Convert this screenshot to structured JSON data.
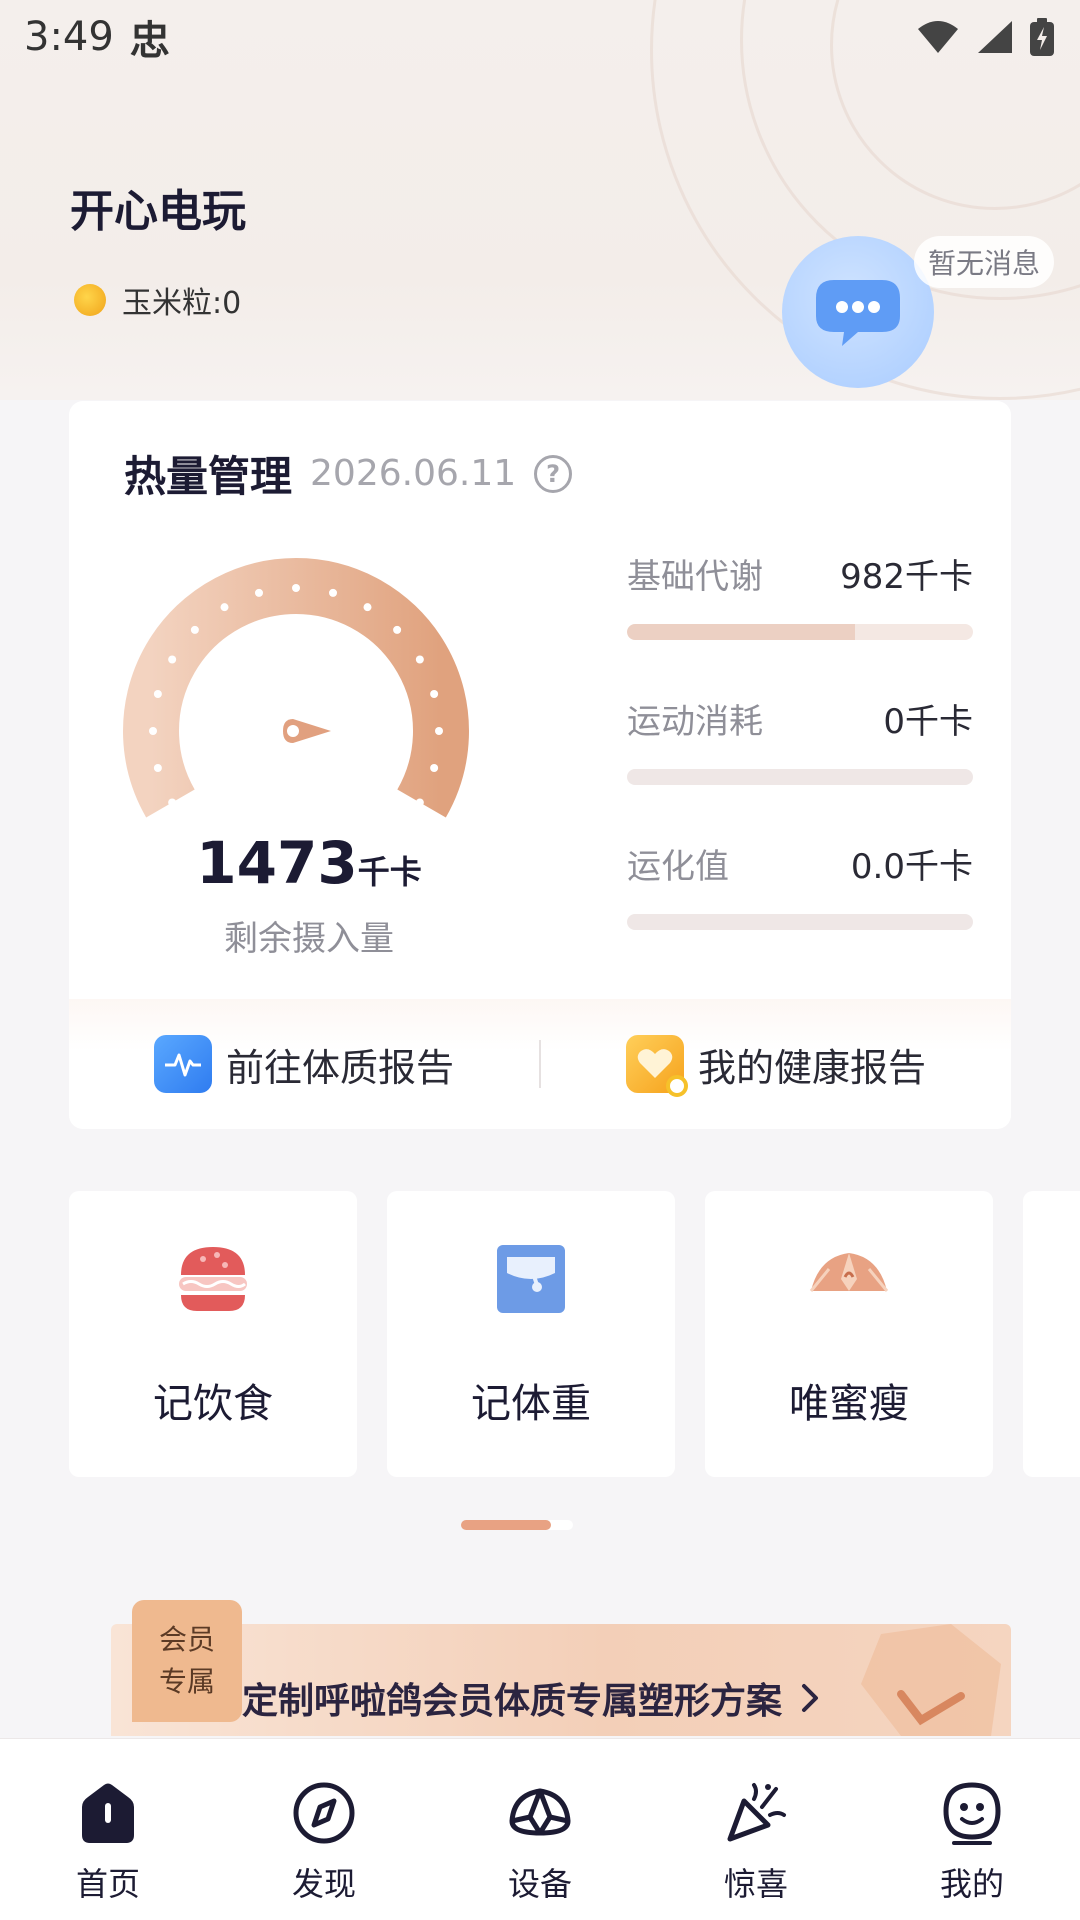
{
  "status_bar": {
    "time": "3:49",
    "notif_glyph": "忠"
  },
  "profile": {
    "name": "开心电玩",
    "points_label": "玉米粒:0",
    "message_badge": "暂无消息"
  },
  "calorie": {
    "title": "热量管理",
    "date": "2026.06.11",
    "help_glyph": "?",
    "remaining_value": "1473",
    "remaining_unit": "千卡",
    "remaining_label": "剩余摄入量",
    "metrics": [
      {
        "label": "基础代谢",
        "value": "982千卡",
        "fill": 0.66
      },
      {
        "label": "运动消耗",
        "value": "0千卡",
        "fill": 0
      },
      {
        "label": "运化值",
        "value": "0.0千卡",
        "fill": 0
      }
    ],
    "reports": [
      {
        "label": "前往体质报告"
      },
      {
        "label": "我的健康报告"
      }
    ]
  },
  "shortcuts": [
    {
      "label": "记饮食",
      "icon": "burger-icon"
    },
    {
      "label": "记体重",
      "icon": "scale-icon"
    },
    {
      "label": "唯蜜瘦",
      "icon": "shell-icon"
    }
  ],
  "member": {
    "tag_line1": "会员",
    "tag_line2": "专属",
    "text": "定制呼啦鸽会员体质专属塑形方案"
  },
  "tabs": [
    {
      "label": "首页",
      "icon": "home-icon"
    },
    {
      "label": "发现",
      "icon": "compass-icon"
    },
    {
      "label": "设备",
      "icon": "device-icon"
    },
    {
      "label": "惊喜",
      "icon": "party-popper-icon"
    },
    {
      "label": "我的",
      "icon": "smiley-icon"
    }
  ],
  "colors": {
    "accent": "#e8a283",
    "text": "#1c1b33",
    "muted": "#8f8f98"
  }
}
